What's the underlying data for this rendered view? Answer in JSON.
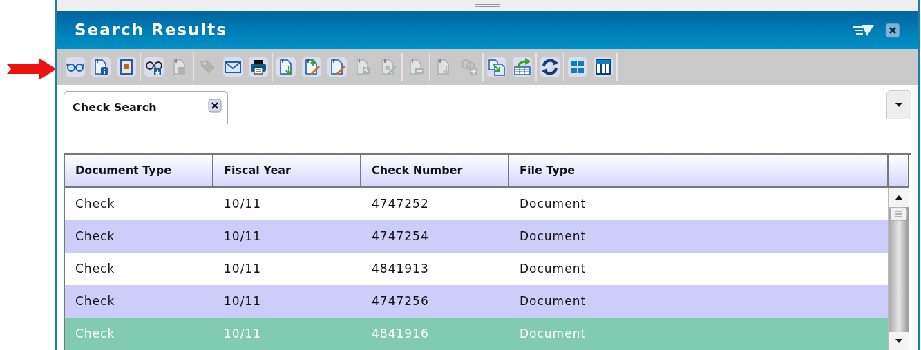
{
  "panel": {
    "title": "Search Results"
  },
  "toolbar": [
    [
      {
        "kind": "glasses",
        "disabled": false
      },
      {
        "kind": "doc-info",
        "disabled": false
      },
      {
        "kind": "notebook",
        "disabled": false
      }
    ],
    [
      {
        "kind": "glasses-star",
        "disabled": false
      },
      {
        "kind": "doc-image",
        "disabled": true
      }
    ],
    [
      {
        "kind": "tag",
        "disabled": true
      },
      {
        "kind": "envelope",
        "disabled": false
      },
      {
        "kind": "printer",
        "disabled": false
      }
    ],
    [
      {
        "kind": "doc-down",
        "disabled": false
      },
      {
        "kind": "doc-down-pencil",
        "disabled": false
      },
      {
        "kind": "doc-pencil",
        "disabled": false
      },
      {
        "kind": "doc-cursor",
        "disabled": true
      },
      {
        "kind": "doc-x",
        "disabled": true
      }
    ],
    [
      {
        "kind": "doc-minus",
        "disabled": true
      }
    ],
    [
      {
        "kind": "doc-down",
        "disabled": true
      },
      {
        "kind": "add",
        "disabled": true
      }
    ],
    [
      {
        "kind": "doc-copy",
        "disabled": false
      },
      {
        "kind": "table-export",
        "disabled": false
      }
    ],
    [
      {
        "kind": "refresh",
        "disabled": false
      }
    ],
    [
      {
        "kind": "grid",
        "disabled": false
      },
      {
        "kind": "columns",
        "disabled": false
      }
    ]
  ],
  "tabs": [
    {
      "label": "Check Search",
      "selected": true
    }
  ],
  "table": {
    "columns": [
      "Document Type",
      "Fiscal Year",
      "Check Number",
      "File Type"
    ],
    "rows": [
      {
        "cells": [
          "Check",
          "10/11",
          "4747252",
          "Document"
        ],
        "selected": false
      },
      {
        "cells": [
          "Check",
          "10/11",
          "4747254",
          "Document"
        ],
        "selected": false
      },
      {
        "cells": [
          "Check",
          "10/11",
          "4841913",
          "Document"
        ],
        "selected": false
      },
      {
        "cells": [
          "Check",
          "10/11",
          "4747256",
          "Document"
        ],
        "selected": false
      },
      {
        "cells": [
          "Check",
          "10/11",
          "4841916",
          "Document"
        ],
        "selected": true
      }
    ]
  }
}
